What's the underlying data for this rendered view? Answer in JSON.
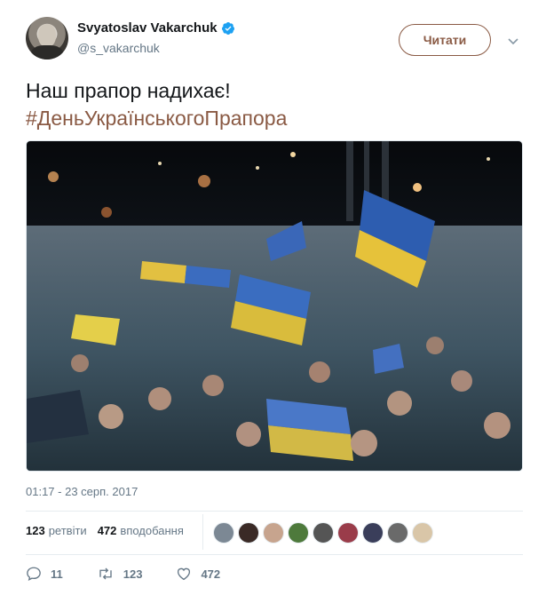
{
  "author": {
    "name": "Svyatoslav Vakarchuk",
    "handle": "@s_vakarchuk",
    "verified_icon": "verified-badge-icon"
  },
  "header": {
    "follow_label": "Читати",
    "caret_icon": "chevron-down-icon"
  },
  "tweet": {
    "text": "Наш прапор надихає!",
    "hashtag": "#ДеньУкраїнськогоПрапора",
    "timestamp": "01:17 - 23 серп. 2017"
  },
  "stats": {
    "retweets_count": "123",
    "retweets_label": "ретвіти",
    "likes_count": "472",
    "likes_label": "вподобання"
  },
  "actions": {
    "reply_count": "11",
    "retweet_count": "123",
    "like_count": "472"
  },
  "colors": {
    "accent": "#8a5a44",
    "muted": "#657786",
    "verified": "#1da1f2"
  }
}
